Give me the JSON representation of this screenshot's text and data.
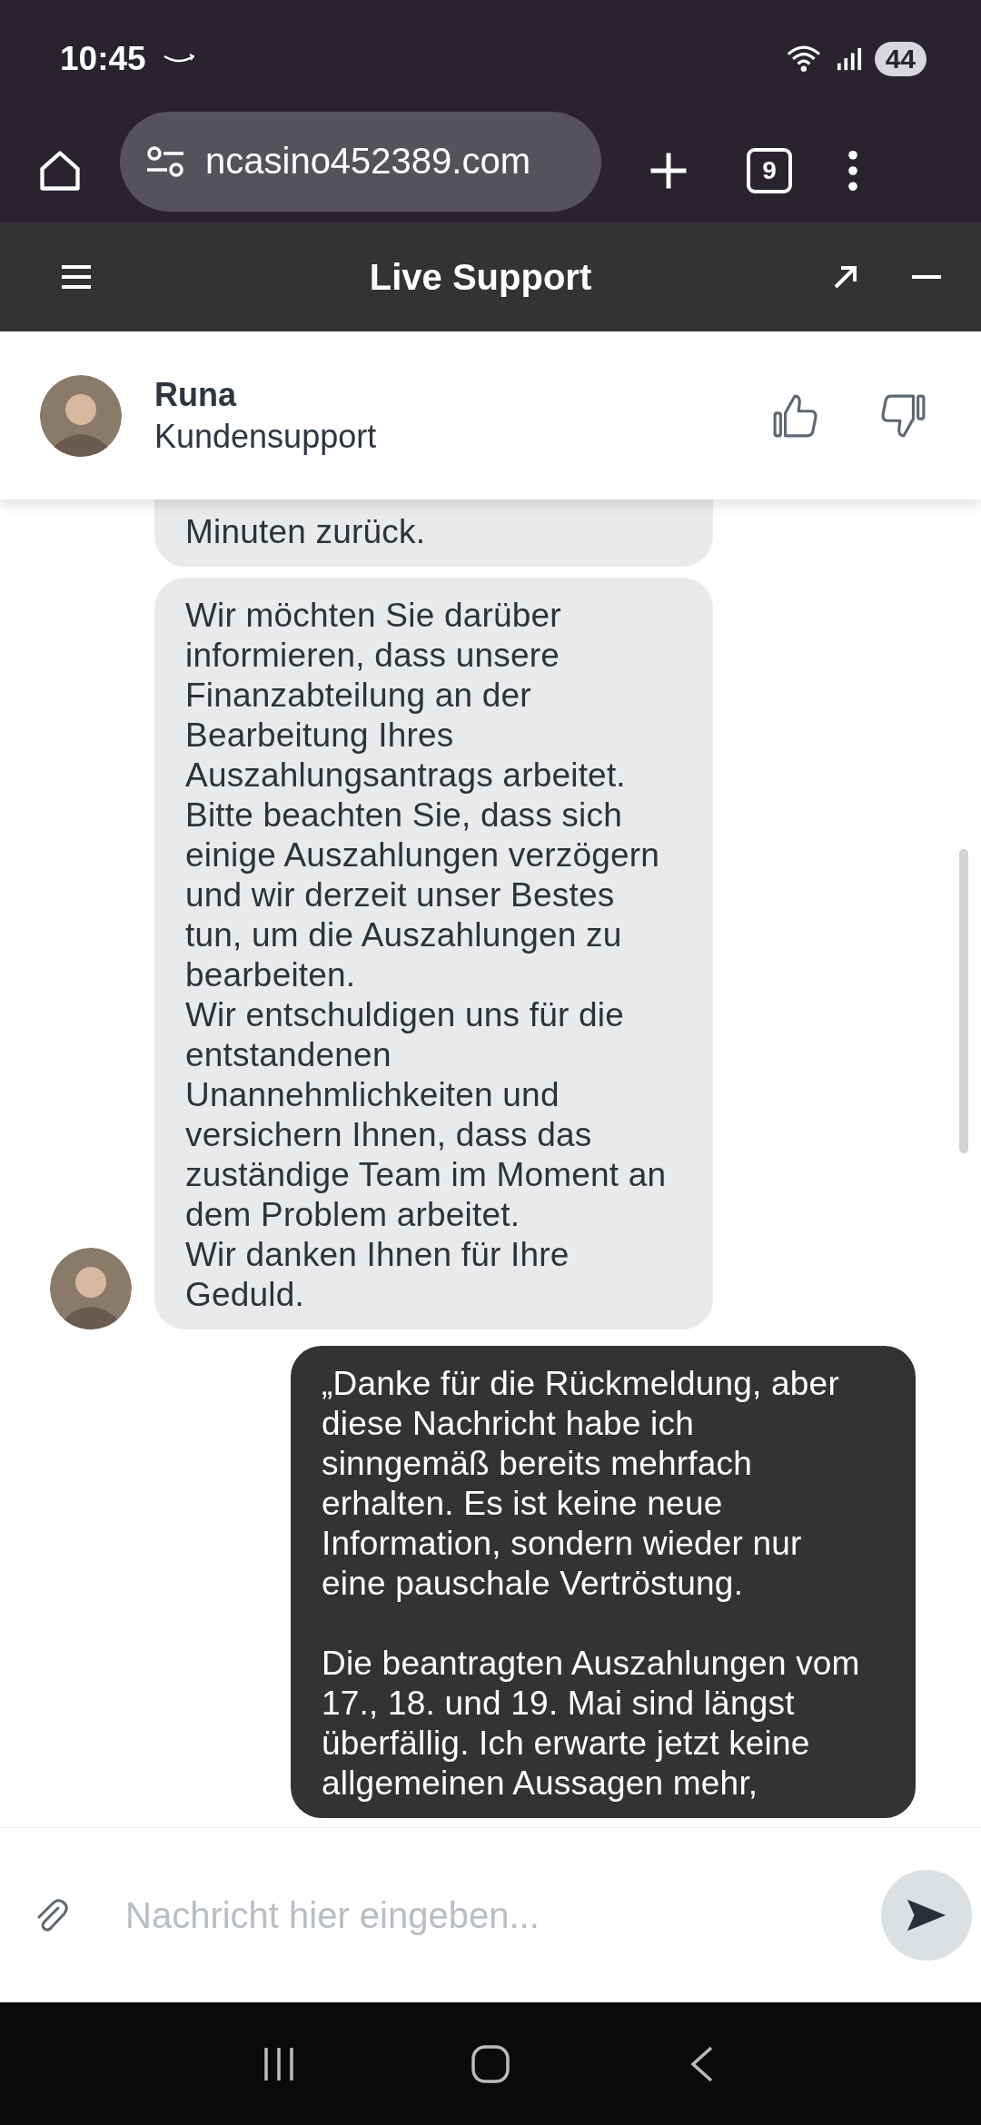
{
  "status_bar": {
    "time": "10:45",
    "battery": "44"
  },
  "browser": {
    "url": "ncasino452389.com",
    "tab_count": "9"
  },
  "header": {
    "title": "Live Support"
  },
  "agent": {
    "name": "Runa",
    "role": "Kundensupport"
  },
  "messages": [
    {
      "kind": "agent",
      "show_avatar": false,
      "text": "Minuten zurück."
    },
    {
      "kind": "agent",
      "show_avatar": true,
      "text": "Wir möchten Sie darüber informieren, dass unsere Finanzabteilung an der Bearbeitung Ihres Auszahlungsantrags arbeitet. Bitte beachten Sie, dass sich einige Auszahlungen verzögern und wir derzeit unser Bestes tun, um die Auszahlungen zu bearbeiten.\nWir entschuldigen uns für die entstandenen Unannehmlichkeiten und versichern Ihnen, dass das zuständige Team im Moment an dem Problem arbeitet.\nWir danken Ihnen für Ihre Geduld."
    },
    {
      "kind": "user",
      "text": "„Danke für die Rückmeldung, aber diese Nachricht habe ich sinngemäß bereits mehrfach erhalten. Es ist keine neue Information, sondern wieder nur eine pauschale Vertröstung.\n\nDie beantragten Auszahlungen vom 17., 18. und 19. Mai sind längst überfällig. Ich erwarte jetzt keine allgemeinen Aussagen mehr,"
    }
  ],
  "composer": {
    "placeholder": "Nachricht hier eingeben..."
  }
}
